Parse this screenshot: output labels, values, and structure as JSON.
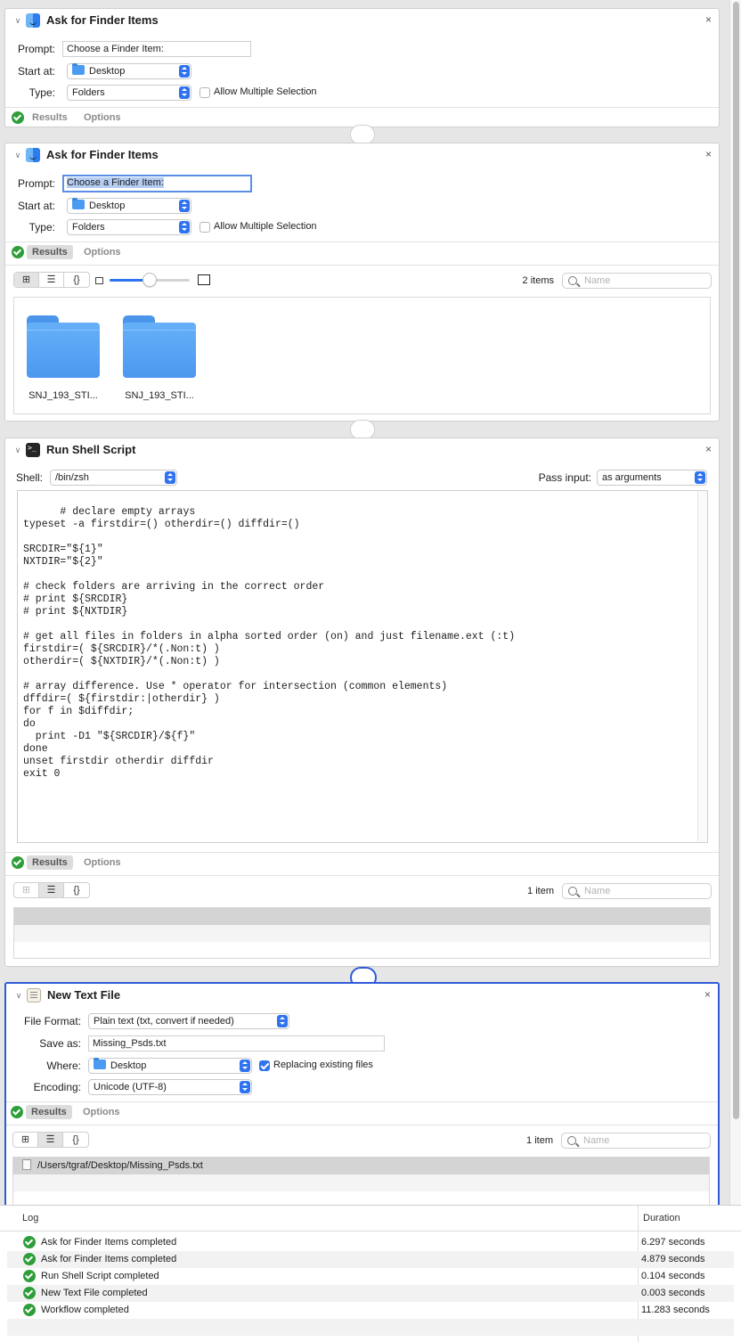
{
  "actions": [
    {
      "title": "Ask for Finder Items",
      "prompt_label": "Prompt:",
      "prompt_value": "Choose a Finder Item:",
      "start_label": "Start at:",
      "start_value": "Desktop",
      "type_label": "Type:",
      "type_value": "Folders",
      "allow_multiple": "Allow Multiple Selection",
      "tabs": [
        "Results",
        "Options"
      ]
    },
    {
      "title": "Ask for Finder Items",
      "prompt_label": "Prompt:",
      "prompt_value": "Choose a Finder Item:",
      "start_label": "Start at:",
      "start_value": "Desktop",
      "type_label": "Type:",
      "type_value": "Folders",
      "allow_multiple": "Allow Multiple Selection",
      "tabs": [
        "Results",
        "Options"
      ],
      "item_count": "2 items",
      "search_placeholder": "Name",
      "view_buttons": [
        "⊞",
        "☰",
        "{}"
      ],
      "files": [
        "SNJ_193_STI...",
        "SNJ_193_STI..."
      ]
    },
    {
      "title": "Run Shell Script",
      "shell_label": "Shell:",
      "shell_value": "/bin/zsh",
      "pass_label": "Pass input:",
      "pass_value": "as arguments",
      "script": "# declare empty arrays\ntypeset -a firstdir=() otherdir=() diffdir=()\n\nSRCDIR=\"${1}\"\nNXTDIR=\"${2}\"\n\n# check folders are arriving in the correct order\n# print ${SRCDIR}\n# print ${NXTDIR}\n\n# get all files in folders in alpha sorted order (on) and just filename.ext (:t)\nfirstdir=( ${SRCDIR}/*(.Non:t) )\notherdir=( ${NXTDIR}/*(.Non:t) )\n\n# array difference. Use * operator for intersection (common elements)\ndffdir=( ${firstdir:|otherdir} )\nfor f in $diffdir;\ndo\n  print -D1 \"${SRCDIR}/${f}\"\ndone\nunset firstdir otherdir diffdir\nexit 0",
      "tabs": [
        "Results",
        "Options"
      ],
      "item_count": "1 item",
      "search_placeholder": "Name",
      "view_buttons": [
        "⊞",
        "☰",
        "{}"
      ]
    },
    {
      "title": "New Text File",
      "format_label": "File Format:",
      "format_value": "Plain text (txt, convert if needed)",
      "saveas_label": "Save as:",
      "saveas_value": "Missing_Psds.txt",
      "where_label": "Where:",
      "where_value": "Desktop",
      "replacing": "Replacing existing files",
      "encoding_label": "Encoding:",
      "encoding_value": "Unicode (UTF-8)",
      "tabs": [
        "Results",
        "Options"
      ],
      "item_count": "1 item",
      "search_placeholder": "Name",
      "view_buttons": [
        "⊞",
        "☰",
        "{}"
      ],
      "result_path": "/Users/tgraf/Desktop/Missing_Psds.txt"
    }
  ],
  "close_glyph": "×",
  "chevron_glyph": "∨",
  "log": {
    "col_log": "Log",
    "col_duration": "Duration",
    "rows": [
      {
        "text": "Ask for Finder Items completed",
        "duration": "6.297 seconds"
      },
      {
        "text": "Ask for Finder Items completed",
        "duration": "4.879 seconds"
      },
      {
        "text": "Run Shell Script completed",
        "duration": "0.104 seconds"
      },
      {
        "text": "New Text File completed",
        "duration": "0.003 seconds"
      },
      {
        "text": "Workflow completed",
        "duration": "11.283 seconds"
      }
    ]
  },
  "colors": {
    "accent": "#2f73f0",
    "success": "#2e9e3a",
    "selected_border": "#2f5bd8"
  }
}
